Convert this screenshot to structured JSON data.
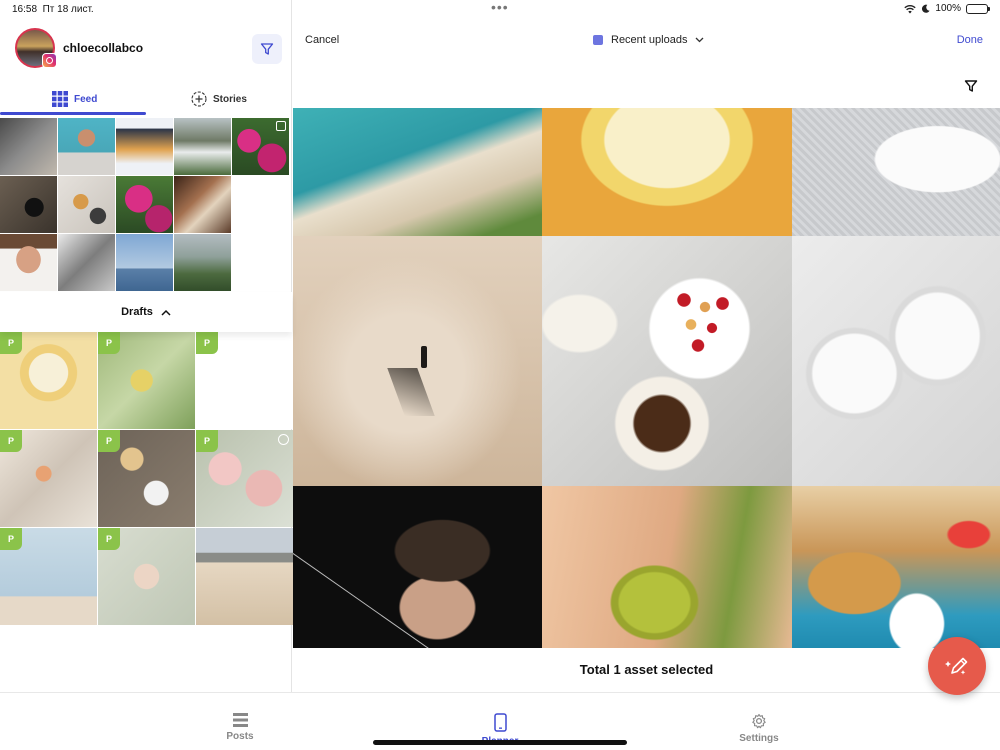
{
  "status": {
    "time": "16:58",
    "date": "Пт 18 лист.",
    "battery": "100%"
  },
  "profile": {
    "username": "chloecollabco"
  },
  "tabs": {
    "feed": "Feed",
    "stories": "Stories"
  },
  "drafts": {
    "label": "Drafts"
  },
  "picker": {
    "cancel": "Cancel",
    "source": "Recent uploads",
    "done": "Done",
    "selection": "Total 1 asset selected"
  },
  "draft_badge": "P",
  "nav": {
    "posts": "Posts",
    "planner": "Planner",
    "settings": "Settings"
  },
  "colors": {
    "accent": "#3f4ad0",
    "fab": "#e65a4b",
    "draft_badge": "#8bc34a"
  }
}
